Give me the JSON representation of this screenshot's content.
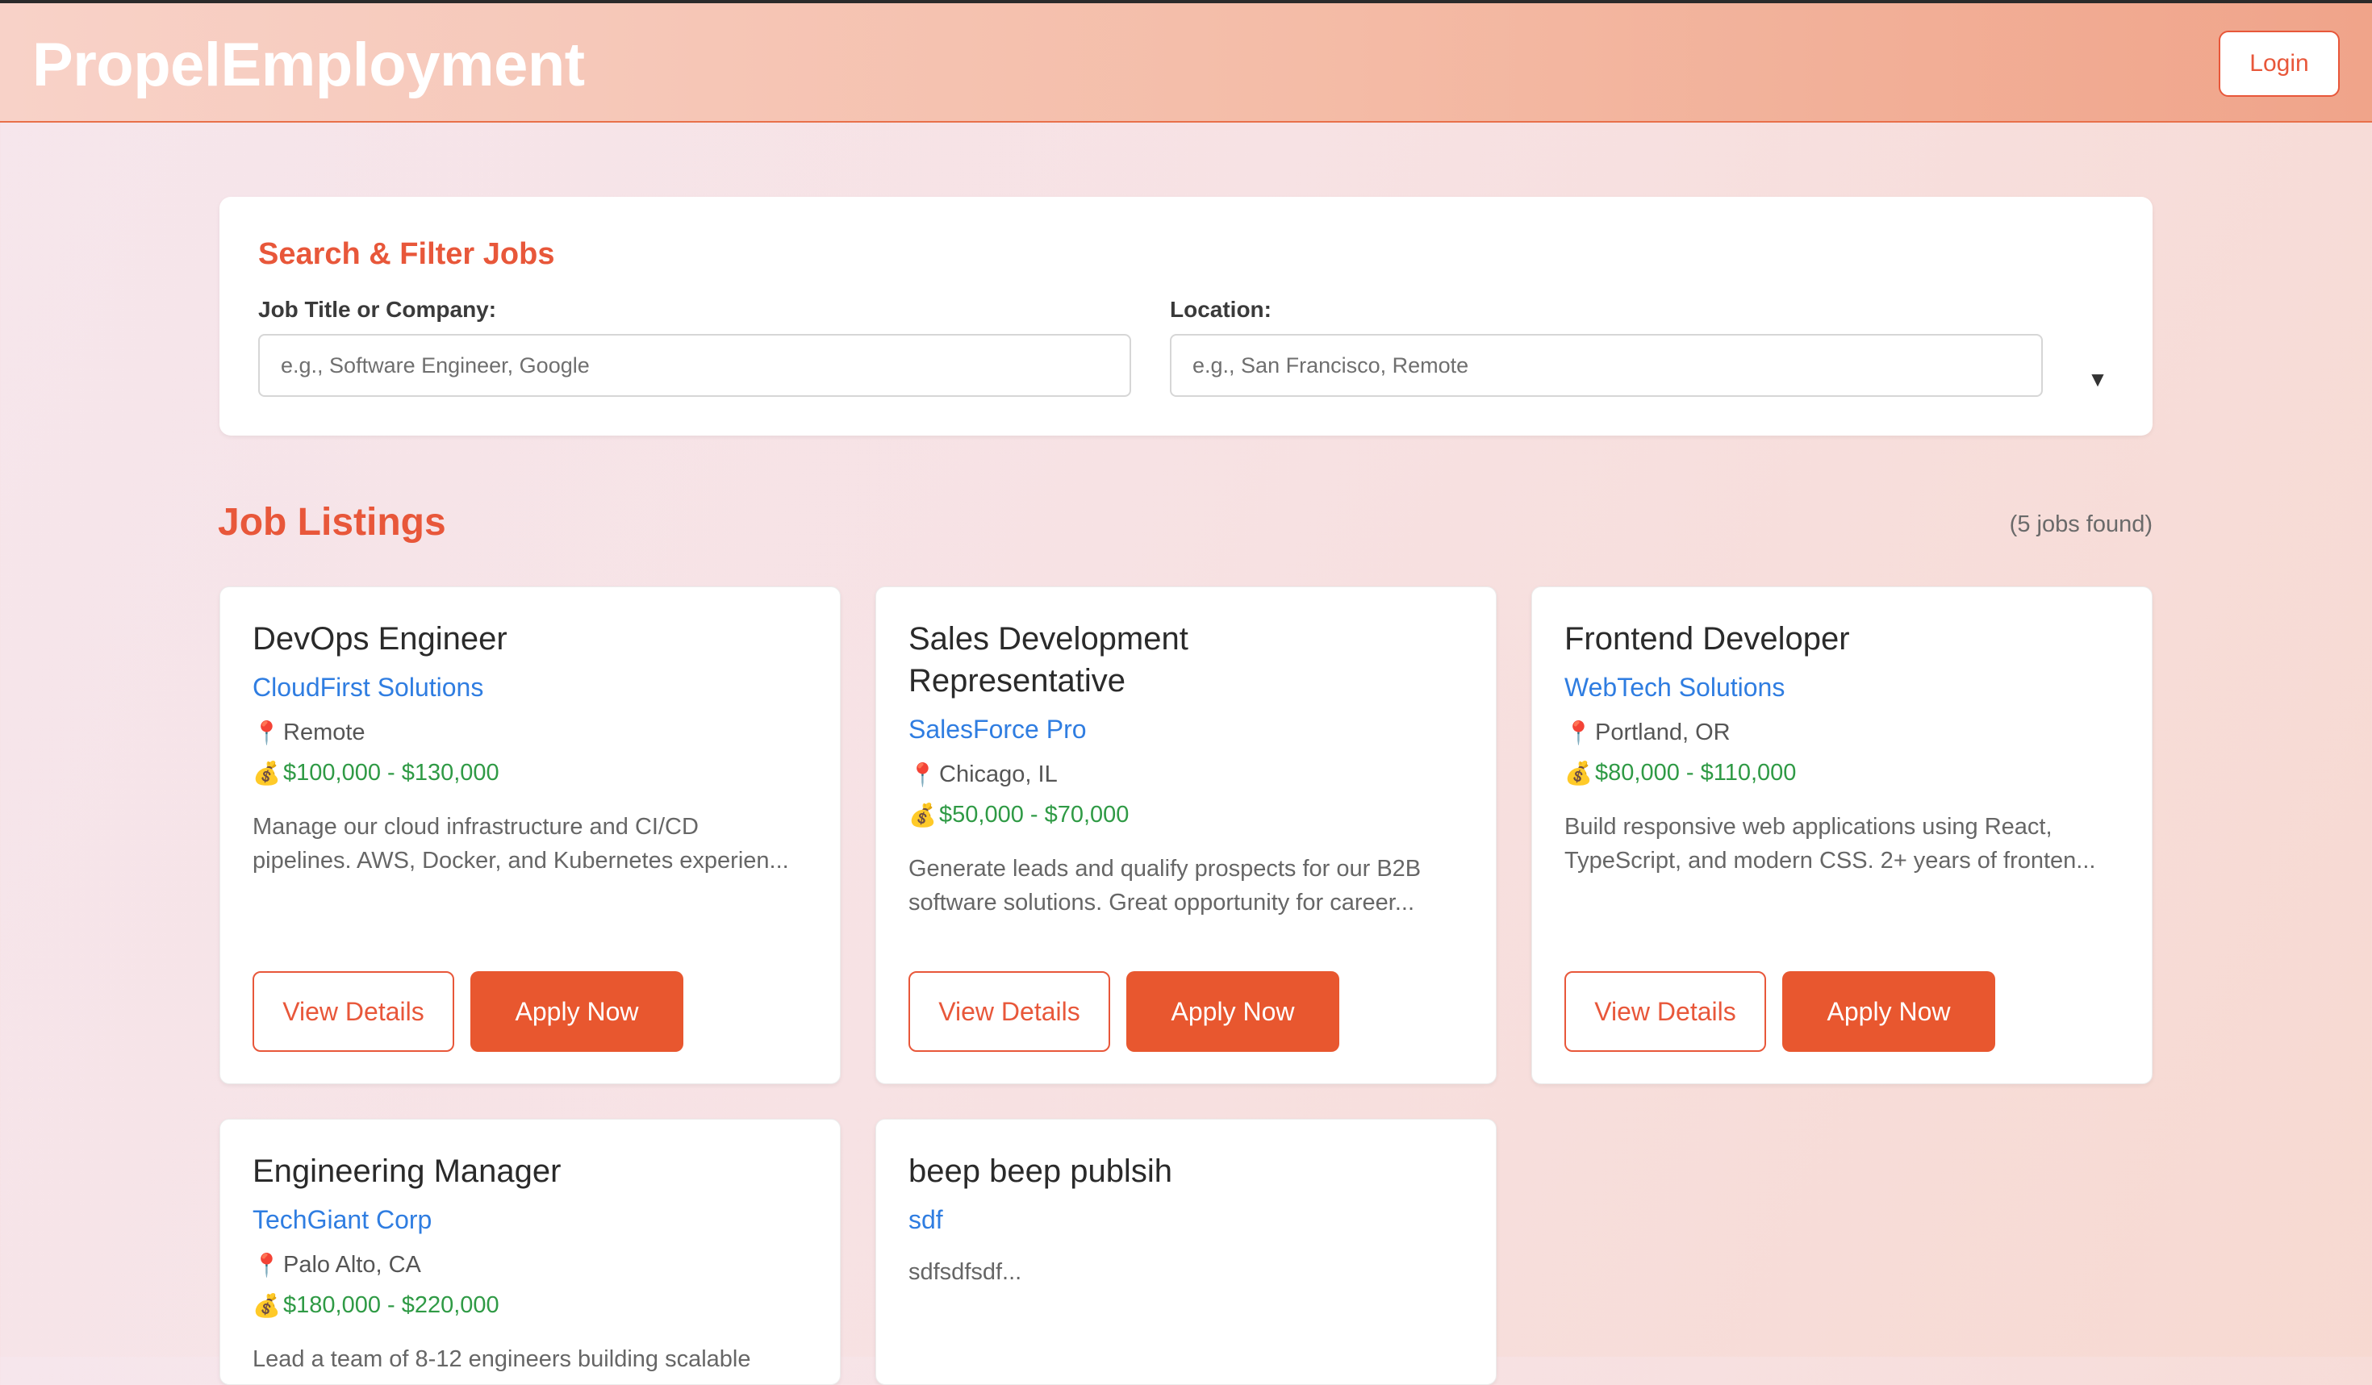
{
  "header": {
    "brand": "PropelEmployment",
    "login_label": "Login"
  },
  "filters": {
    "title": "Search & Filter Jobs",
    "job_label": "Job Title or Company:",
    "job_placeholder": "e.g., Software Engineer, Google",
    "location_label": "Location:",
    "location_placeholder": "e.g., San Francisco, Remote",
    "toggle_icon": "▼"
  },
  "listings": {
    "title": "Job Listings",
    "count": "(5 jobs found)",
    "view_label": "View Details",
    "apply_label": "Apply Now",
    "location_icon": "📍",
    "salary_icon": "💰",
    "jobs": [
      {
        "title": "DevOps Engineer",
        "company": "CloudFirst Solutions",
        "location": "Remote",
        "salary": "$100,000 - $130,000",
        "description_line1": "Manage our cloud infrastructure and CI/CD",
        "description_line2": "pipelines. AWS, Docker, and Kubernetes experien..."
      },
      {
        "title_line1": "Sales Development",
        "title_line2": "Representative",
        "company": "SalesForce Pro",
        "location": "Chicago, IL",
        "salary": "$50,000 - $70,000",
        "description_line1": "Generate leads and qualify prospects for our B2B",
        "description_line2": "software solutions. Great opportunity for career..."
      },
      {
        "title": "Frontend Developer",
        "company": "WebTech Solutions",
        "location": "Portland, OR",
        "salary": "$80,000 - $110,000",
        "description_line1": "Build responsive web applications using React,",
        "description_line2": "TypeScript, and modern CSS. 2+ years of fronten..."
      },
      {
        "title": "Engineering Manager",
        "company": "TechGiant Corp",
        "location": "Palo Alto, CA",
        "salary": "$180,000 - $220,000",
        "description_line1": "Lead a team of 8-12 engineers building scalable"
      },
      {
        "title": "beep beep publsih",
        "company": "sdf",
        "description_line1": "sdfsdfsdf..."
      }
    ]
  },
  "colors": {
    "accent": "#e8573a",
    "company_link": "#2f7de1",
    "salary": "#2f9a45"
  }
}
